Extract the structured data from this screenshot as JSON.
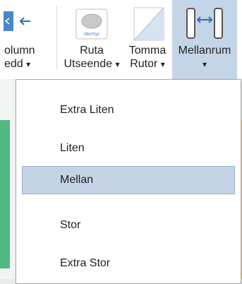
{
  "ribbon": {
    "buttons": [
      {
        "id": "kolumn",
        "label_line1": "olumn",
        "label_line2": "edd",
        "has_dropdown": true,
        "icon": "column-width-icon"
      },
      {
        "id": "ruta",
        "label_line1": "Ruta",
        "label_line2": "Utseende",
        "has_dropdown": true,
        "icon": "cell-appearance-icon",
        "icon_text": "Abc/Xyz"
      },
      {
        "id": "tomma",
        "label_line1": "Tomma",
        "label_line2": "Rutor",
        "has_dropdown": true,
        "icon": "empty-cells-icon"
      },
      {
        "id": "mellanrum",
        "label_line1": "Mellanrum",
        "label_line2": "",
        "has_dropdown": true,
        "active": true,
        "icon": "spacing-icon"
      }
    ],
    "dropdown_glyph": "▾"
  },
  "menu": {
    "items": [
      {
        "label": "Extra Liten",
        "selected": false
      },
      {
        "label": "Liten",
        "selected": false
      },
      {
        "label": "Mellan",
        "selected": true
      },
      {
        "label": "Stor",
        "selected": false
      },
      {
        "label": "Extra Stor",
        "selected": false
      }
    ]
  },
  "colors": {
    "accent_green": "#52b882",
    "accent_yellow": "#efd27a",
    "active_bg": "#c5d5e8",
    "selected_bg": "#c4d3e6"
  }
}
